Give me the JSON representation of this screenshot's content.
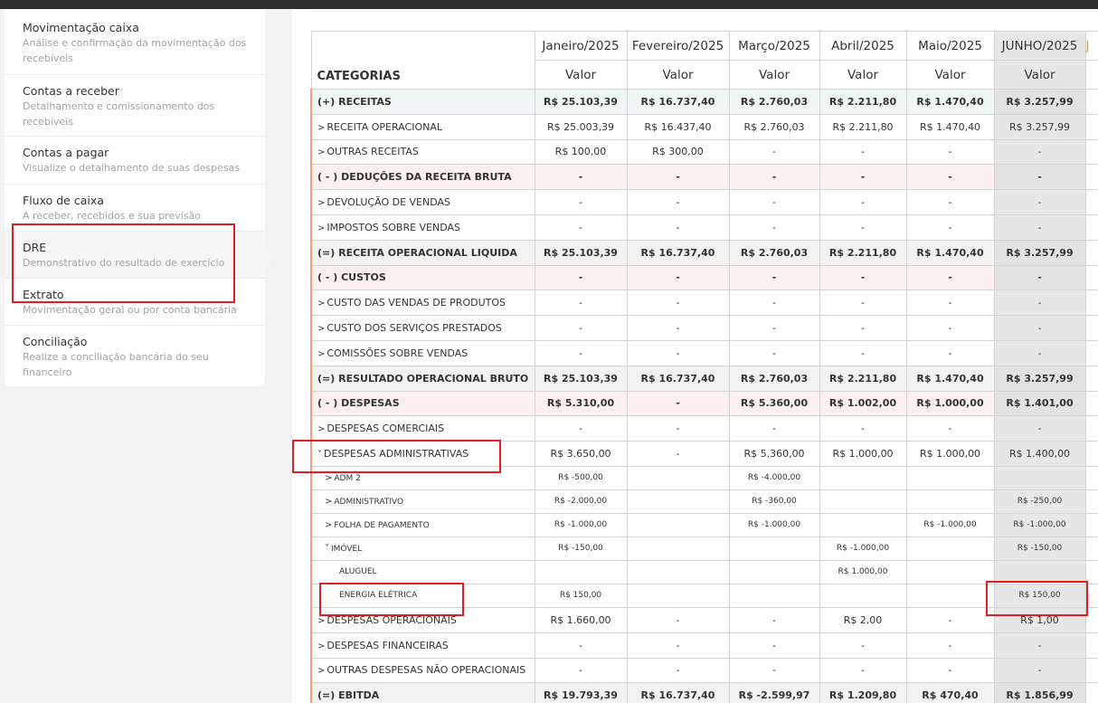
{
  "sidebar": {
    "items": [
      {
        "title": "Movimentação caixa",
        "desc": "Análise e confirmação da movimentação dos recebíveis"
      },
      {
        "title": "Contas a receber",
        "desc": "Detalhamento e comissionamento dos recebíveis"
      },
      {
        "title": "Contas a pagar",
        "desc": "Visualize o detalhamento de suas despesas"
      },
      {
        "title": "Fluxo de caixa",
        "desc": "A receber, recebidos e sua previsão"
      },
      {
        "title": "DRE",
        "desc": "Demonstrativo do resultado de exercício"
      },
      {
        "title": "Extrato",
        "desc": "Movimentação geral ou por conta bancária"
      },
      {
        "title": "Conciliação",
        "desc": "Realize a conciliação bancária do seu financeiro"
      }
    ]
  },
  "table": {
    "categories_header": "CATEGORIAS",
    "value_header": "Valor",
    "months": [
      "Janeiro/2025",
      "Fevereiro/2025",
      "Março/2025",
      "Abril/2025",
      "Maio/2025",
      "JUNHO/2025"
    ],
    "extra_month_fragment": "J",
    "rows": [
      {
        "label": "(+) RECEITAS",
        "style": "sec-rec",
        "values": [
          "R$ 25.103,39",
          "R$ 16.737,40",
          "R$ 2.760,03",
          "R$ 2.211,80",
          "R$ 1.470,40",
          "R$ 3.257,99"
        ]
      },
      {
        "label": "RECEITA OPERACIONAL",
        "chev": ">",
        "values": [
          "R$ 25.003,39",
          "R$ 16.437,40",
          "R$ 2.760,03",
          "R$ 2.211,80",
          "R$ 1.470,40",
          "R$ 3.257,99"
        ]
      },
      {
        "label": "OUTRAS RECEITAS",
        "chev": ">",
        "values": [
          "R$ 100,00",
          "R$ 300,00",
          "-",
          "-",
          "-",
          "-"
        ]
      },
      {
        "label": "( - ) DEDUÇÕES DA RECEITA BRUTA",
        "style": "sec-ded",
        "values": [
          "-",
          "-",
          "-",
          "-",
          "-",
          "-"
        ]
      },
      {
        "label": "DEVOLUÇÃO DE VENDAS",
        "chev": ">",
        "values": [
          "-",
          "-",
          "-",
          "-",
          "-",
          "-"
        ]
      },
      {
        "label": "IMPOSTOS SOBRE VENDAS",
        "chev": ">",
        "values": [
          "-",
          "-",
          "-",
          "-",
          "-",
          "-"
        ]
      },
      {
        "label": "(=) RECEITA OPERACIONAL LIQUIDA",
        "style": "sec-tot",
        "values": [
          "R$ 25.103,39",
          "R$ 16.737,40",
          "R$ 2.760,03",
          "R$ 2.211,80",
          "R$ 1.470,40",
          "R$ 3.257,99"
        ]
      },
      {
        "label": "( - ) CUSTOS",
        "style": "sec-ded",
        "values": [
          "-",
          "-",
          "-",
          "-",
          "-",
          "-"
        ]
      },
      {
        "label": "CUSTO DAS VENDAS DE PRODUTOS",
        "chev": ">",
        "values": [
          "-",
          "-",
          "-",
          "-",
          "-",
          "-"
        ]
      },
      {
        "label": "CUSTO DOS SERVIÇOS PRESTADOS",
        "chev": ">",
        "values": [
          "-",
          "-",
          "-",
          "-",
          "-",
          "-"
        ]
      },
      {
        "label": "COMISSÕES SOBRE VENDAS",
        "chev": ">",
        "values": [
          "-",
          "-",
          "-",
          "-",
          "-",
          "-"
        ]
      },
      {
        "label": "(=) RESULTADO OPERACIONAL BRUTO",
        "style": "sec-tot",
        "values": [
          "R$ 25.103,39",
          "R$ 16.737,40",
          "R$ 2.760,03",
          "R$ 2.211,80",
          "R$ 1.470,40",
          "R$ 3.257,99"
        ]
      },
      {
        "label": "( - ) DESPESAS",
        "style": "sec-ded",
        "values": [
          "R$ 5.310,00",
          "-",
          "R$ 5.360,00",
          "R$ 1.002,00",
          "R$ 1.000,00",
          "R$ 1.401,00"
        ]
      },
      {
        "label": "DESPESAS COMERCIAIS",
        "chev": ">",
        "values": [
          "-",
          "-",
          "-",
          "-",
          "-",
          "-"
        ]
      },
      {
        "label": "DESPESAS ADMINISTRATIVAS",
        "chev": "v",
        "values": [
          "R$ 3.650,00",
          "-",
          "R$ 5.360,00",
          "R$ 1.000,00",
          "R$ 1.000,00",
          "R$ 1.400,00"
        ]
      },
      {
        "label": "ADM 2",
        "chev": ">",
        "level": 1,
        "values": [
          "R$ -500,00",
          "",
          "R$ -4.000,00",
          "",
          "",
          ""
        ]
      },
      {
        "label": "ADMINISTRATIVO",
        "chev": ">",
        "level": 1,
        "values": [
          "R$ -2.000,00",
          "",
          "R$ -360,00",
          "",
          "",
          "R$ -250,00"
        ]
      },
      {
        "label": "FOLHA DE PAGAMENTO",
        "chev": ">",
        "level": 1,
        "values": [
          "R$ -1.000,00",
          "",
          "R$ -1.000,00",
          "",
          "R$ -1.000,00",
          "R$ -1.000,00"
        ]
      },
      {
        "label": "IMÓVEL",
        "chev": "v",
        "level": 1,
        "values": [
          "R$ -150,00",
          "",
          "",
          "R$ -1.000,00",
          "",
          "R$ -150,00"
        ]
      },
      {
        "label": "ALUGUEL",
        "level": 2,
        "values": [
          "",
          "",
          "",
          "R$ 1.000,00",
          "",
          ""
        ]
      },
      {
        "label": "ENERGIA ELÉTRICA",
        "level": 2,
        "values": [
          "R$ 150,00",
          "",
          "",
          "",
          "",
          "R$ 150,00"
        ]
      },
      {
        "label": "DESPESAS OPERACIONAIS",
        "chev": ">",
        "values": [
          "R$ 1.660,00",
          "-",
          "-",
          "R$ 2,00",
          "-",
          "R$ 1,00"
        ]
      },
      {
        "label": "DESPESAS FINANCEIRAS",
        "chev": ">",
        "values": [
          "-",
          "-",
          "-",
          "-",
          "-",
          "-"
        ]
      },
      {
        "label": "OUTRAS DESPESAS NÃO OPERACIONAIS",
        "chev": ">",
        "values": [
          "-",
          "-",
          "-",
          "-",
          "-",
          "-"
        ]
      },
      {
        "label": "(=) EBITDA",
        "style": "sec-tot",
        "values": [
          "R$ 19.793,39",
          "R$ 16.737,40",
          "R$ -2.599,97",
          "R$ 1.209,80",
          "R$ 470,40",
          "R$ 1.856,99"
        ]
      }
    ]
  },
  "colors": {
    "highlight_box": "#e02020",
    "receitas_bg": "#eef7f6",
    "deducoes_bg": "#fcf0f0",
    "totals_bg": "#f2f2f2",
    "current_month_bg": "#e7e7e7"
  }
}
